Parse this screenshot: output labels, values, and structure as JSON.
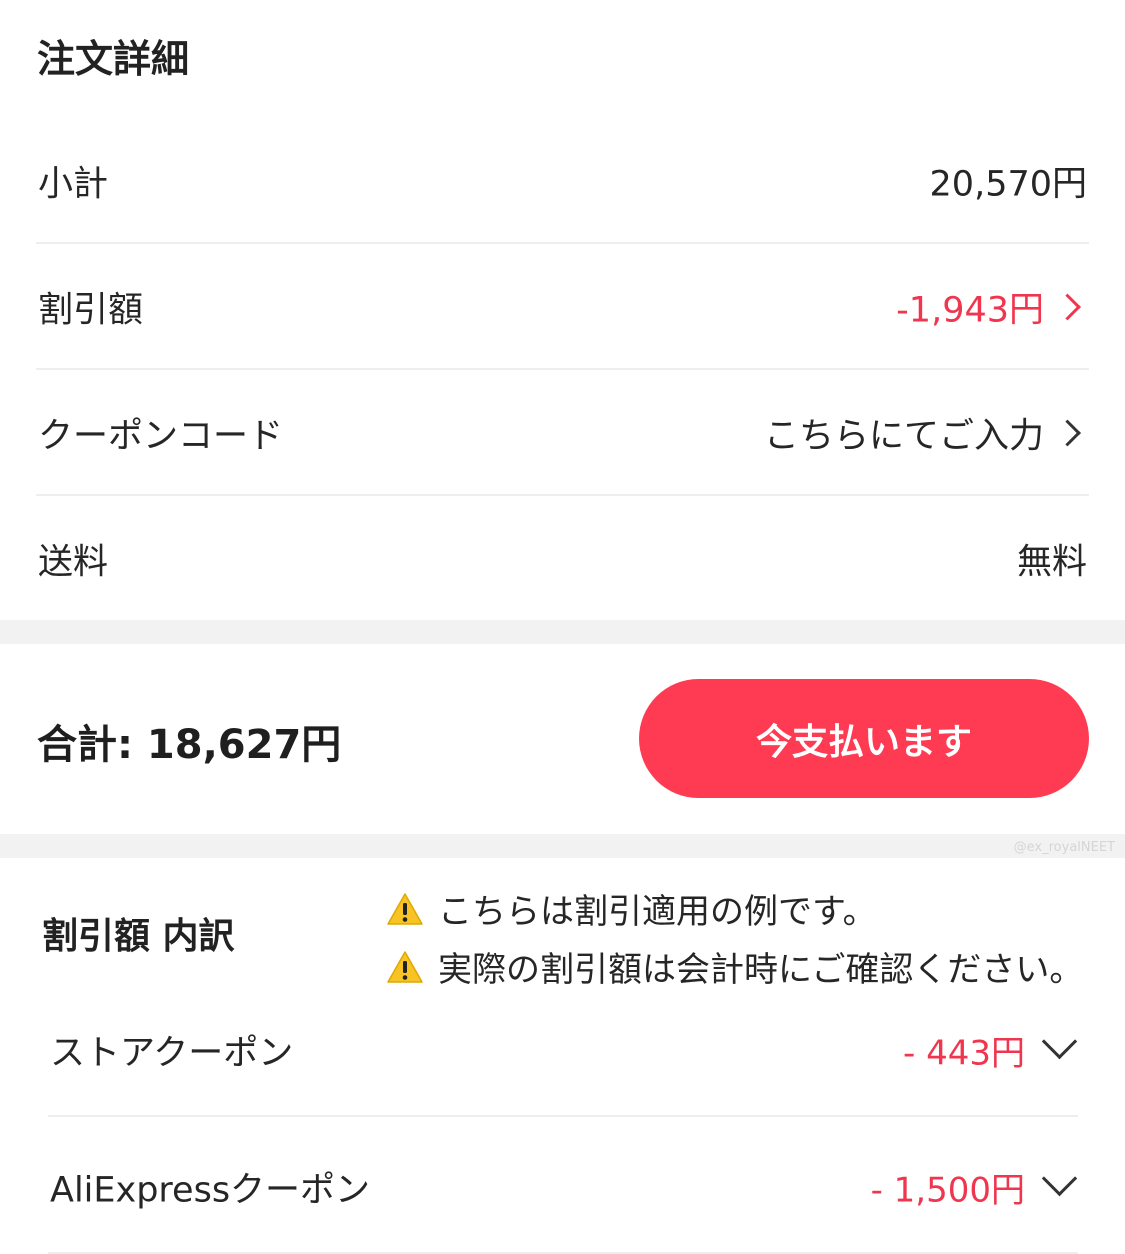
{
  "order_details": {
    "title": "注文詳細",
    "rows": [
      {
        "label": "小計",
        "value": "20,570円"
      },
      {
        "label": "割引額",
        "value": "-1,943円"
      },
      {
        "label": "クーポンコード",
        "value": "こちらにてご入力"
      },
      {
        "label": "送料",
        "value": "無料"
      }
    ]
  },
  "checkout": {
    "total_text": "合計: 18,627円",
    "pay_button": "今支払います"
  },
  "watermark": "@ex_royalNEET",
  "breakdown": {
    "title": "割引額 内訳",
    "notices": [
      "こちらは割引適用の例です。",
      "実際の割引額は会計時にご確認ください。"
    ],
    "items": [
      {
        "label": "ストアクーポン",
        "value": "- 443円"
      },
      {
        "label": "AliExpressクーポン",
        "value": "- 1,500円"
      }
    ]
  },
  "colors": {
    "accent": "#fe3b52",
    "discount_text": "#f0364f",
    "section_gap": "#f2f2f2"
  }
}
